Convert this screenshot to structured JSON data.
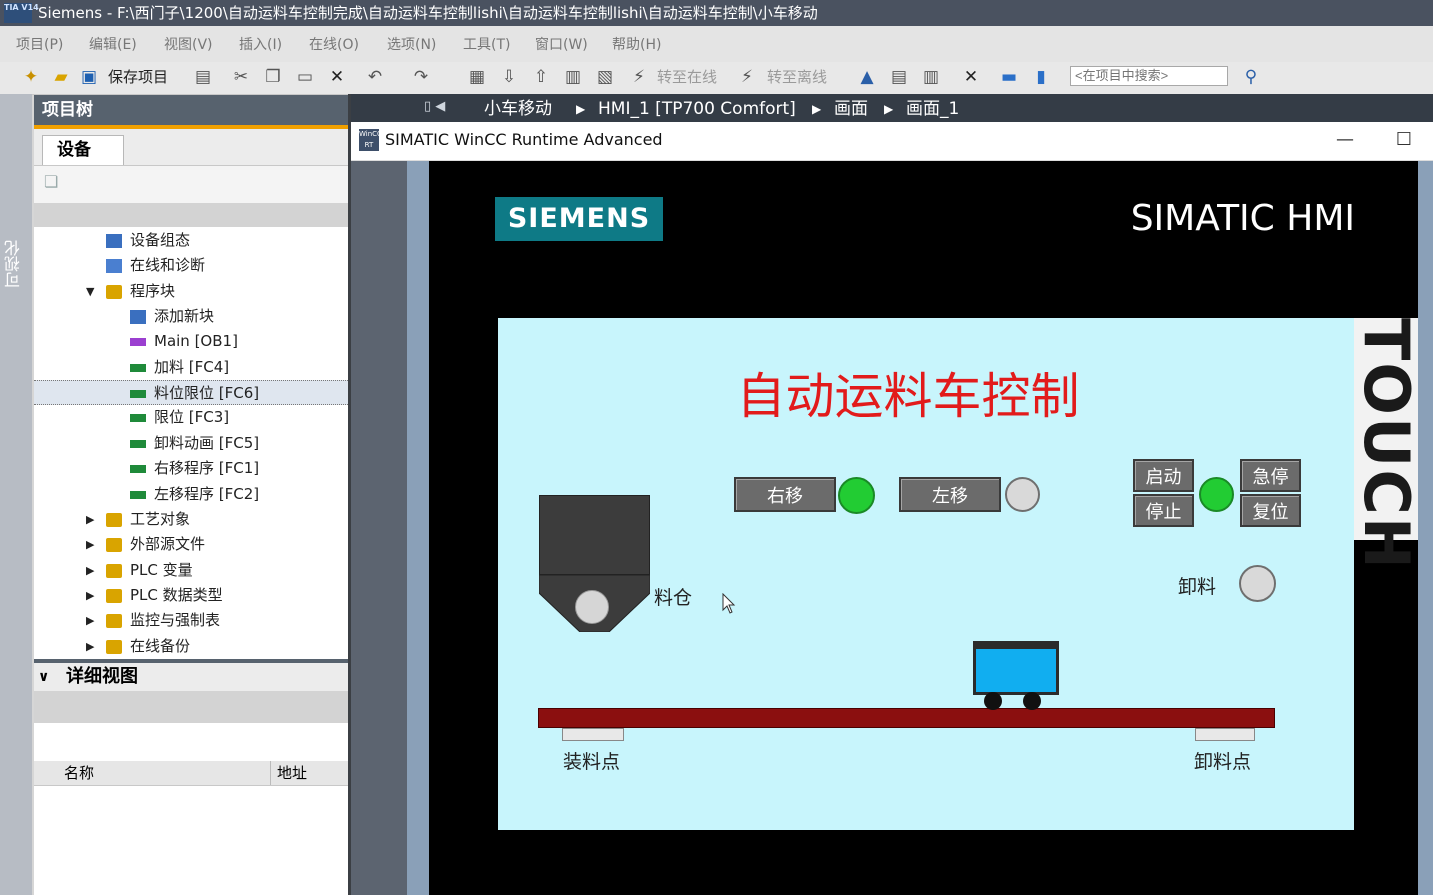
{
  "titlebar": {
    "app_logo": "TIA V14",
    "text": "Siemens  -  F:\\西门子\\1200\\自动运料车控制完成\\自动运料车控制lishi\\自动运料车控制lishi\\自动运料车控制\\小车移动"
  },
  "menu": [
    "项目(P)",
    "编辑(E)",
    "视图(V)",
    "插入(I)",
    "在线(O)",
    "选项(N)",
    "工具(T)",
    "窗口(W)",
    "帮助(H)"
  ],
  "toolbar": {
    "save_project": "保存项目",
    "go_online": "转至在线",
    "go_offline": "转至离线",
    "search_placeholder": "<在项目中搜索>"
  },
  "side_strip_label": "可视化",
  "project_tree": {
    "header": "项目树",
    "tab": "设备",
    "items": [
      {
        "label": "设备组态",
        "icon": "device-config-icon",
        "indent": 2,
        "expand": ""
      },
      {
        "label": "在线和诊断",
        "icon": "online-diagnostics-icon",
        "indent": 2,
        "expand": ""
      },
      {
        "label": "程序块",
        "icon": "folder-icon",
        "indent": 2,
        "expand": "▼"
      },
      {
        "label": "添加新块",
        "icon": "add-block-icon",
        "indent": 3,
        "expand": ""
      },
      {
        "label": "Main [OB1]",
        "icon": "ob-block-icon",
        "indent": 3,
        "expand": ""
      },
      {
        "label": "加料 [FC4]",
        "icon": "fc-block-icon",
        "indent": 3,
        "expand": ""
      },
      {
        "label": "料位限位 [FC6]",
        "icon": "fc-block-icon",
        "indent": 3,
        "expand": "",
        "selected": true
      },
      {
        "label": "限位 [FC3]",
        "icon": "fc-block-icon",
        "indent": 3,
        "expand": ""
      },
      {
        "label": "卸料动画 [FC5]",
        "icon": "fc-block-icon",
        "indent": 3,
        "expand": ""
      },
      {
        "label": "右移程序 [FC1]",
        "icon": "fc-block-icon",
        "indent": 3,
        "expand": ""
      },
      {
        "label": "左移程序 [FC2]",
        "icon": "fc-block-icon",
        "indent": 3,
        "expand": ""
      },
      {
        "label": "工艺对象",
        "icon": "folder-icon",
        "indent": 2,
        "expand": "▶"
      },
      {
        "label": "外部源文件",
        "icon": "folder-icon",
        "indent": 2,
        "expand": "▶"
      },
      {
        "label": "PLC 变量",
        "icon": "folder-icon",
        "indent": 2,
        "expand": "▶"
      },
      {
        "label": "PLC 数据类型",
        "icon": "folder-icon",
        "indent": 2,
        "expand": "▶"
      },
      {
        "label": "监控与强制表",
        "icon": "folder-icon",
        "indent": 2,
        "expand": "▶"
      },
      {
        "label": "在线备份",
        "icon": "folder-icon",
        "indent": 2,
        "expand": "▶"
      }
    ]
  },
  "detail_view": {
    "header": "详细视图",
    "col_name": "名称",
    "col_address": "地址"
  },
  "breadcrumb": [
    "小车移动",
    "HMI_1 [TP700 Comfort]",
    "画面",
    "画面_1"
  ],
  "runtime_window": {
    "title": "SIMATIC WinCC Runtime Advanced",
    "icon_text": "WinCC RT"
  },
  "hmi": {
    "brand": "SIEMENS",
    "product": "SIMATIC HMI",
    "touch": "TOUCH",
    "screen_title": "自动运料车控制",
    "buttons": {
      "move_right": "右移",
      "move_left": "左移",
      "start": "启动",
      "stop": "停止",
      "emergency_stop": "急停",
      "reset": "复位"
    },
    "lamps": {
      "move_right": "on",
      "move_left": "off",
      "run": "on",
      "unload": "off"
    },
    "labels": {
      "hopper": "料仓",
      "unload": "卸料",
      "load_point": "装料点",
      "unload_point": "卸料点"
    },
    "colors": {
      "screen_bg": "#c8f5fc",
      "title_red": "#e21b1b",
      "lamp_green": "#22cc33",
      "track_red": "#8b0f0f",
      "cart_blue": "#11aef0",
      "logo_teal": "#0e7a86"
    }
  }
}
